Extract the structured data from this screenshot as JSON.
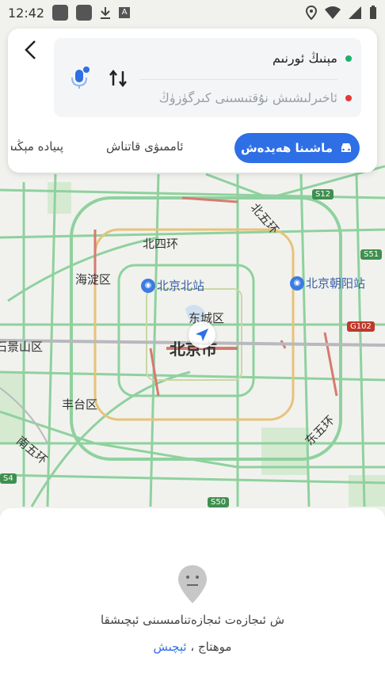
{
  "status": {
    "time": "12:42"
  },
  "colors": {
    "accent": "#2e6fe6",
    "origin_dot": "#1db26b",
    "dest_dot": "#e53935",
    "road_green": "#8fd19e",
    "road_red": "#d77a6f"
  },
  "route": {
    "origin": "مېنىڭ ئورنىم",
    "destination": "ئاخىرلىشىش نۇقتىسىنى كىرگۈزۈڭ"
  },
  "modes": {
    "drive": "ماشىنا ھەيدەش",
    "transit": "ئاممىۋى قاتناش",
    "walk": "پىيادە مېڭىش"
  },
  "map_labels": {
    "north4": "北四环",
    "haidian": "海淀区",
    "bj_north": "北京北站",
    "bj_chaoyang": "北京朝阳站",
    "dongcheng": "东城区",
    "beijing": "北京市",
    "shijingshan": "石景山区",
    "fengtai": "丰台区",
    "south5": "南五环",
    "east5": "东五环",
    "north5": "北五环"
  },
  "shields": {
    "s12": "S12",
    "s51": "S51",
    "g102": "G102",
    "s50": "S50",
    "s4": "S4"
  },
  "error": {
    "line1": "ش ئىجازەت ئىجازەتنامىسىنى ئېچىشقا",
    "line2_text": "موھتاج ،",
    "line2_link": "ئېچىش"
  }
}
